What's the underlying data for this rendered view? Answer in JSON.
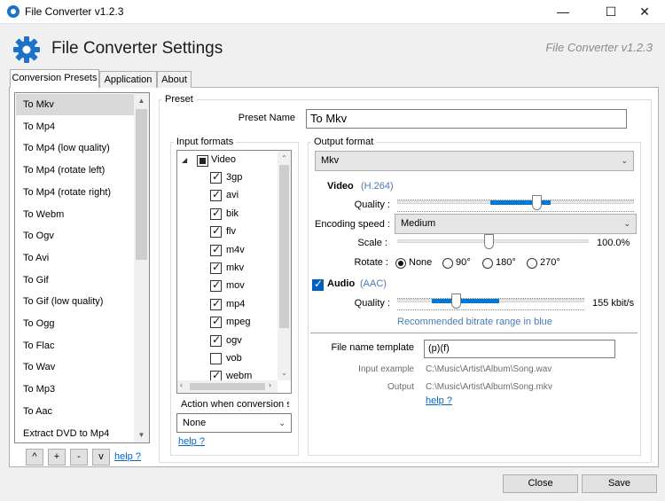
{
  "window": {
    "title": "File Converter v1.2.3",
    "minimize": "—",
    "maximize": "☐",
    "close": "✕"
  },
  "header": {
    "title": "File Converter Settings",
    "version": "File Converter v1.2.3"
  },
  "tabs": [
    {
      "label": "Conversion Presets"
    },
    {
      "label": "Application"
    },
    {
      "label": "About"
    }
  ],
  "presets": {
    "items": [
      "To Mkv",
      "To Mp4",
      "To Mp4 (low quality)",
      "To Mp4 (rotate left)",
      "To Mp4 (rotate right)",
      "To Webm",
      "To Ogv",
      "To Avi",
      "To Gif",
      "To Gif (low quality)",
      "To Ogg",
      "To Flac",
      "To Wav",
      "To Mp3",
      "To Aac",
      "Extract DVD to Mp4"
    ],
    "selected_index": 0
  },
  "list_buttons": {
    "up": "^",
    "add": "+",
    "remove": "-",
    "down": "v",
    "help": "help ?"
  },
  "preset": {
    "group_label": "Preset",
    "name_label": "Preset Name",
    "name_value": "To Mkv",
    "input_formats": {
      "group_label": "Input formats",
      "category": "Video",
      "formats": [
        {
          "name": "3gp",
          "checked": true
        },
        {
          "name": "avi",
          "checked": true
        },
        {
          "name": "bik",
          "checked": true
        },
        {
          "name": "flv",
          "checked": true
        },
        {
          "name": "m4v",
          "checked": true
        },
        {
          "name": "mkv",
          "checked": true
        },
        {
          "name": "mov",
          "checked": true
        },
        {
          "name": "mp4",
          "checked": true
        },
        {
          "name": "mpeg",
          "checked": true
        },
        {
          "name": "ogv",
          "checked": true
        },
        {
          "name": "vob",
          "checked": false
        },
        {
          "name": "webm",
          "checked": true
        }
      ],
      "action_label": "Action when conversion s",
      "action_value": "None",
      "help": "help ?"
    },
    "output": {
      "group_label": "Output format",
      "format_value": "Mkv",
      "video_label": "Video",
      "video_codec": "(H.264)",
      "quality_label": "Quality :",
      "encoding_speed_label": "Encoding speed :",
      "encoding_speed_value": "Medium",
      "scale_label": "Scale :",
      "scale_value": "100.0%",
      "rotate_label": "Rotate :",
      "rotate_options": [
        "None",
        "90°",
        "180°",
        "270°"
      ],
      "rotate_selected": 0,
      "audio_label": "Audio",
      "audio_codec": "(AAC)",
      "audio_quality_label": "Quality :",
      "audio_bitrate": "155 kbit/s",
      "bitrate_hint": "Recommended bitrate range in blue",
      "filename_label": "File name template",
      "filename_value": "(p)(f)",
      "input_example_label": "Input example",
      "input_example_value": "C:\\Music\\Artist\\Album\\Song.wav",
      "output_label": "Output",
      "output_value": "C:\\Music\\Artist\\Album\\Song.mkv",
      "help": "help ?"
    }
  },
  "footer": {
    "close": "Close",
    "save": "Save"
  },
  "colors": {
    "accent": "#0078d7",
    "link": "#0066cc",
    "codec": "#4a7ab8",
    "logo": "#1a73c8"
  }
}
